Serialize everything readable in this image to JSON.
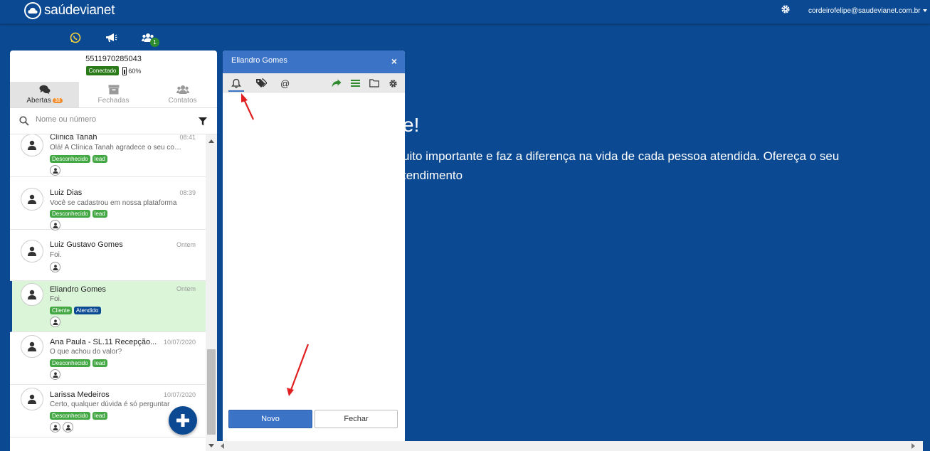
{
  "header": {
    "logo_text": "saúdevianet",
    "user_email": "cordeirofelipe@saudevianet.com.br"
  },
  "quick_icons": {
    "badge_count": "1"
  },
  "welcome": {
    "line1": "e!",
    "line2": "uito importante e faz a diferença na vida de cada pessoa atendida. Ofereça o seu",
    "line3": "tendimento"
  },
  "chat_panel": {
    "phone": "5511970285043",
    "status_label": "Conectado",
    "battery": "60%",
    "tabs": [
      {
        "label": "Abertas",
        "count": "38"
      },
      {
        "label": "Fechadas"
      },
      {
        "label": "Contatos"
      }
    ],
    "search": {
      "placeholder": "Nome ou número"
    },
    "conversations": [
      {
        "name": "Clínica Tanah",
        "time": "08:41",
        "message": "Olá! A Clínica Tanah agradece o seu contato",
        "tags": [
          "Desconhecido",
          "lead"
        ]
      },
      {
        "name": "Luiz Dias",
        "time": "08:39",
        "message": "Você se cadastrou em nossa plataforma",
        "tags": [
          "Desconhecido",
          "lead"
        ]
      },
      {
        "name": "Luiz Gustavo Gomes",
        "time": "Ontem",
        "message": "Foi.",
        "tags": []
      },
      {
        "name": "Eliandro Gomes",
        "time": "Ontem",
        "message": "Foi.",
        "tags": [
          "Cliente",
          "Atendido"
        ]
      },
      {
        "name": "Ana Paula - SL.11 Recepção...",
        "time": "10/07/2020",
        "message": "O que achou do valor?",
        "tags": [
          "Desconhecido",
          "lead"
        ]
      },
      {
        "name": "Larissa Medeiros",
        "time": "10/07/2020",
        "message": "Certo, qualquer dúvida é só perguntar",
        "tags": [
          "Desconhecido",
          "lead"
        ]
      }
    ]
  },
  "contact_panel": {
    "title": "Eliandro Gomes",
    "close": "×",
    "buttons": {
      "novo": "Novo",
      "fechar": "Fechar"
    }
  },
  "colors": {
    "background": "#0b4a93",
    "panel_header": "#3b73c7",
    "connected_badge": "#2b7a19",
    "tag_green": "#43a843",
    "selected_row": "#dbf5d8",
    "annotation_arrow": "#e02020"
  }
}
